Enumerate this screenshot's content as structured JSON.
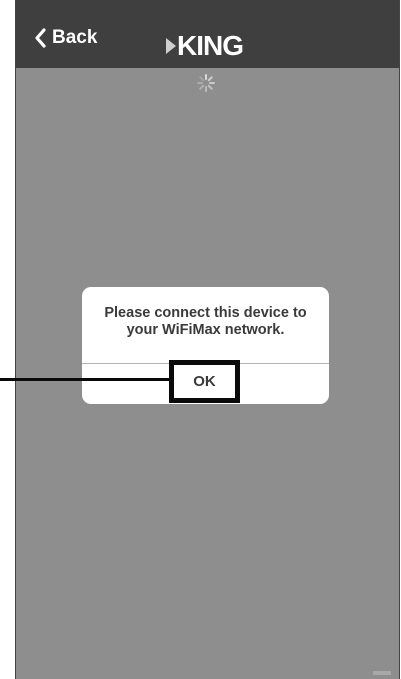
{
  "navbar": {
    "back_label": "Back",
    "logo_text": "KING"
  },
  "dialog": {
    "message": "Please connect this device to your WiFiMax network.",
    "ok_label": "OK"
  },
  "colors": {
    "navbar": "#3f3f3f",
    "screen_background": "#8e8e8e",
    "dialog_background": "#ffffff",
    "callout": "#0a0a0a"
  },
  "icons": {
    "back": "chevron-left-icon",
    "loading": "spinner-icon",
    "logo_mark": "triangle-icon"
  }
}
